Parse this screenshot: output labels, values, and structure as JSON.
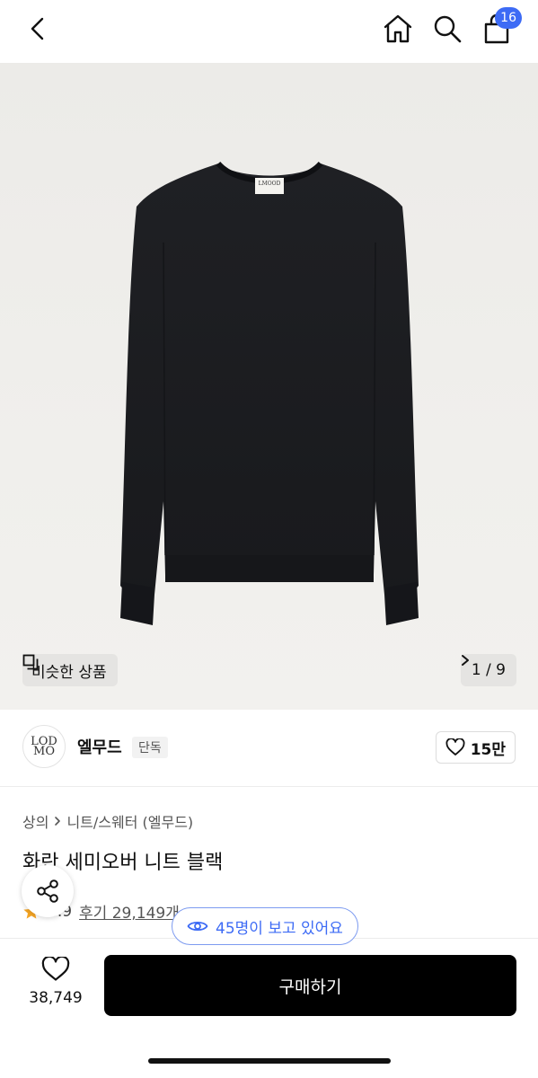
{
  "header": {
    "back_icon": "chevron-left-icon",
    "home_icon": "home-icon",
    "search_icon": "search-icon",
    "cart_icon": "shopping-bag-icon",
    "cart_count": "16"
  },
  "hero": {
    "similar_label": "비슷한 상품",
    "pager": "1 / 9",
    "garment_logo": "LMOOD"
  },
  "brand": {
    "logo_text_line1": "LOD",
    "logo_text_line2": "MO",
    "name": "엘무드",
    "tag": "단독",
    "like_count": "15만"
  },
  "product": {
    "breadcrumb": [
      "상의",
      "니트/스웨터 (엘무드)"
    ],
    "title": "화란 세미오버 니트 블랙",
    "rating": "4.9",
    "reviews": "후기 29,149개"
  },
  "viewing": {
    "text": "45명이 보고 있어요"
  },
  "bottom": {
    "heart_count": "38,749",
    "buy_label": "구매하기"
  },
  "colors": {
    "accent": "#3d6bf5",
    "buy_button": "#000000",
    "sweater": "#1c1d21"
  }
}
